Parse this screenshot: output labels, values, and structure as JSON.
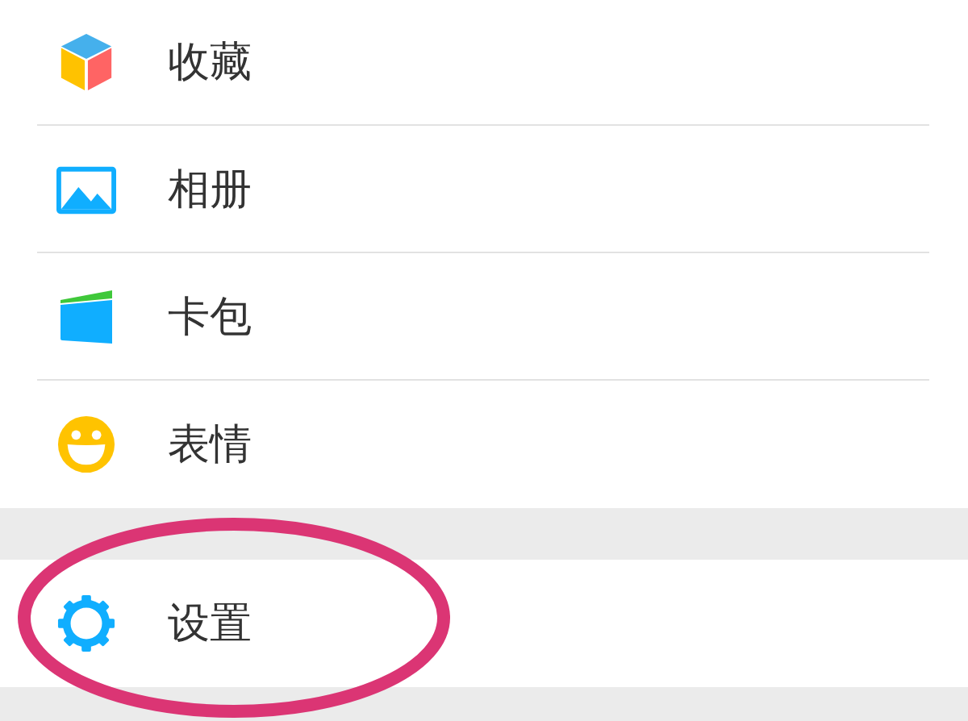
{
  "groups": [
    {
      "items": [
        {
          "kind": "favorites",
          "label": "收藏",
          "circled": false
        },
        {
          "kind": "album",
          "label": "相册",
          "circled": false
        },
        {
          "kind": "cards",
          "label": "卡包",
          "circled": false
        },
        {
          "kind": "stickers",
          "label": "表情",
          "circled": false
        }
      ]
    },
    {
      "items": [
        {
          "kind": "settings",
          "label": "设置",
          "circled": true
        }
      ]
    }
  ]
}
